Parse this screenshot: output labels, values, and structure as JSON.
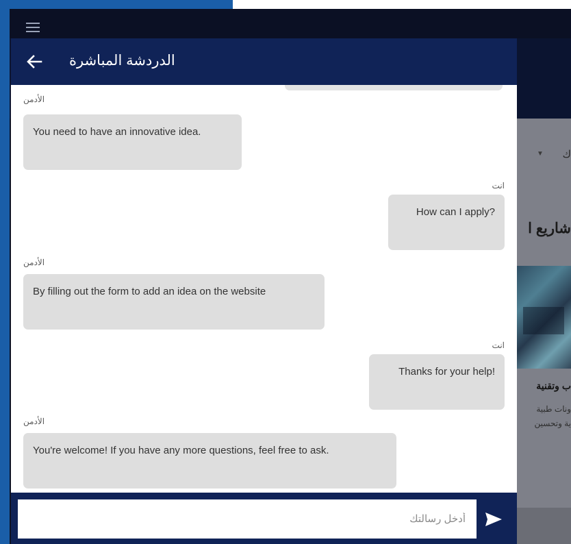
{
  "colors": {
    "outer_background": "#1a5ea8",
    "app_dark": "#0b1024",
    "chat_header": "#102357",
    "bubble": "#dedede",
    "panel": "#ffffff"
  },
  "background_page": {
    "filter_label": "ك",
    "filter_caret_icon": "chevron-down-icon",
    "section_heading": "شاريع ا",
    "card_title": "ب وتقنية",
    "card_line_1": "ونات طبية",
    "card_line_2": "ية وتحسين"
  },
  "chat": {
    "title": "الدردشة المباشرة",
    "back_icon": "arrow-left-icon",
    "messages": [
      {
        "sender": "الأدمن",
        "text": "You need to have an innovative idea.",
        "side": "in"
      },
      {
        "sender": "انت",
        "text": "How can I apply?",
        "side": "out"
      },
      {
        "sender": "الأدمن",
        "text": "By filling out the form to add an idea on the website",
        "side": "in"
      },
      {
        "sender": "انت",
        "text": "Thanks for your help!",
        "side": "out"
      },
      {
        "sender": "الأدمن",
        "text": "You're welcome! If you have any more questions, feel free to ask.",
        "side": "in"
      }
    ],
    "input_placeholder": "أدخل رسالتك",
    "input_value": "",
    "send_icon": "send-icon"
  }
}
